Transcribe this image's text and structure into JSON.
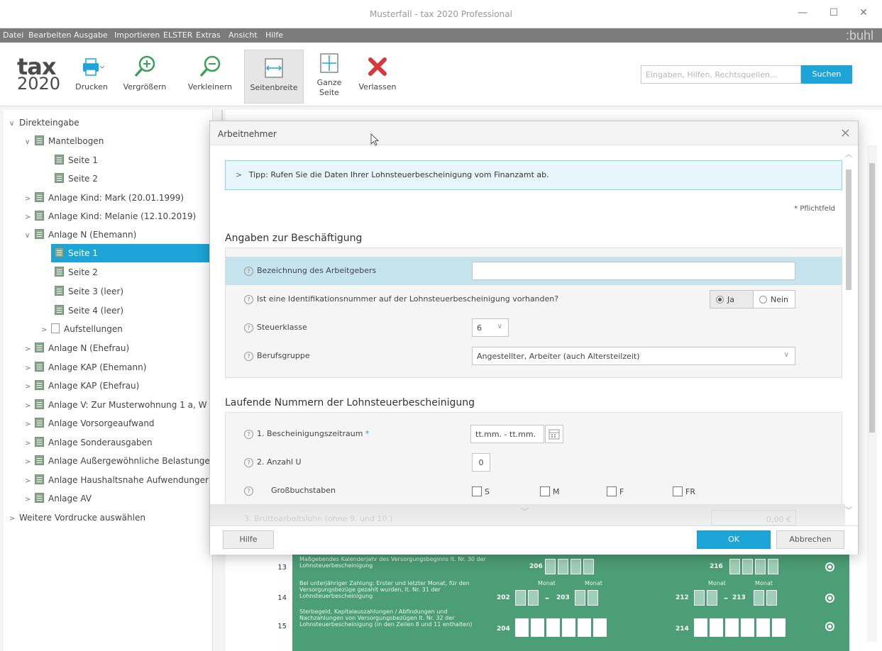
{
  "window": {
    "title": "Musterfall - tax 2020 Professional",
    "min_glyph": "—",
    "max_glyph": "☐",
    "close_glyph": "✕"
  },
  "menu": {
    "items": [
      "Datei",
      "Bearbeiten",
      "Ausgabe",
      "Importieren",
      "ELSTER",
      "Extras",
      "Ansicht",
      "Hilfe"
    ],
    "brand": ":buhl"
  },
  "logo": {
    "line1": "tax",
    "line2": "2020"
  },
  "toolbar": {
    "buttons": [
      {
        "label": "Drucken",
        "icon": "printer-icon"
      },
      {
        "label": "Vergrößern",
        "icon": "zoom-in-icon"
      },
      {
        "label": "Verkleinern",
        "icon": "zoom-out-icon"
      },
      {
        "label": "Seitenbreite",
        "icon": "page-width-icon"
      },
      {
        "label": "Ganze Seite",
        "icon": "whole-page-icon"
      },
      {
        "label": "Verlassen",
        "icon": "exit-icon"
      }
    ],
    "search_placeholder": "Eingaben, Hilfen, Rechtsquellen...",
    "search_button": "Suchen"
  },
  "tree": [
    {
      "label": "Direkteingabe",
      "chevron": "∨"
    },
    {
      "label": "Mantelbogen",
      "chevron": "∨"
    },
    {
      "label": "Seite 1"
    },
    {
      "label": "Seite 2"
    },
    {
      "label": "Anlage Kind: Mark (20.01.1999)",
      "chevron": ">"
    },
    {
      "label": "Anlage Kind: Melanie (12.10.2019)",
      "chevron": ">"
    },
    {
      "label": "Anlage N (Ehemann)",
      "chevron": "∨"
    },
    {
      "label": "Seite 1",
      "selected": true
    },
    {
      "label": "Seite 2"
    },
    {
      "label": "Seite 3 (leer)"
    },
    {
      "label": "Seite 4 (leer)"
    },
    {
      "label": "Aufstellungen",
      "chevron": ">"
    },
    {
      "label": "Anlage N (Ehefrau)",
      "chevron": ">"
    },
    {
      "label": "Anlage KAP (Ehemann)",
      "chevron": ">"
    },
    {
      "label": "Anlage KAP (Ehefrau)",
      "chevron": ">"
    },
    {
      "label": "Anlage V: Zur Musterwohnung 1 a, W",
      "chevron": ">"
    },
    {
      "label": "Anlage Vorsorgeaufwand",
      "chevron": ">"
    },
    {
      "label": "Anlage Sonderausgaben",
      "chevron": ">"
    },
    {
      "label": "Anlage Außergewöhnliche Belastunge",
      "chevron": ">"
    },
    {
      "label": "Anlage Haushaltsnahe Aufwendunger",
      "chevron": ">"
    },
    {
      "label": "Anlage AV",
      "chevron": ">"
    },
    {
      "label": "Weitere Vordrucke auswählen",
      "chevron": ">"
    }
  ],
  "form": {
    "rows": [
      {
        "num": "13",
        "text": "Maßgebendes Kalenderjahr des Versorgungsbeginns lt. Nr. 30 der Lohnsteuerbescheinigung",
        "f1": "206",
        "f2": "216"
      },
      {
        "num": "14",
        "text": "Bei unterjähriger Zahlung: Erster und letzter Monat, für den Versorgungsbezüge gezahlt wurden, lt. Nr. 31 der Lohnsteuerbescheinigung",
        "f1": "202",
        "f1b": "203",
        "f2": "212",
        "f2b": "213",
        "sub1": "Monat",
        "sub2": "Monat"
      },
      {
        "num": "15",
        "text": "Sterbegeld, Kapitalauszahlungen / Abfindungen und Nachzahlungen von Versorgungsbezügen lt. Nr. 32 der Lohnsteuerbescheinigung (in den Zeilen 8 und 11 enthalten)",
        "f1": "204",
        "f2": "214"
      }
    ],
    "mm": "M"
  },
  "dialog": {
    "title": "Arbeitnehmer",
    "tip": "Tipp: Rufen Sie die Daten Ihrer Lohnsteuerbescheinigung vom Finanzamt ab.",
    "tip_chevron": ">",
    "required_note": "* Pflichtfeld",
    "section1": {
      "title": "Angaben zur Beschäftigung",
      "employer_label": "Bezeichnung des Arbeitgebers",
      "employer_value": "",
      "idnr_label": "Ist eine Identifikationsnummer auf der Lohnsteuerbescheinigung vorhanden?",
      "idnr_yes": "Ja",
      "idnr_no": "Nein",
      "idnr_selected": "Ja",
      "taxclass_label": "Steuerklasse",
      "taxclass_value": "6",
      "occupation_label": "Berufsgruppe",
      "occupation_value": "Angestellter, Arbeiter (auch Altersteilzeit)"
    },
    "section2": {
      "title": "Laufende Nummern der Lohnsteuerbescheinigung",
      "period_label": "1. Bescheinigungszeitraum",
      "required_star": "*",
      "period_value": "tt.mm. - tt.mm.",
      "count_label": "2. Anzahl U",
      "count_value": "0",
      "letters_label": "Großbuchstaben",
      "checkboxes": [
        "S",
        "M",
        "F",
        "FR"
      ],
      "faded_label": "3. Bruttoarbeitslohn (ohne 9. und 10.)",
      "faded_value": "0,00 €"
    },
    "help_button": "Hilfe",
    "ok_button": "OK",
    "cancel_button": "Abbrechen"
  },
  "colors": {
    "accent": "#1ca5d6",
    "form_green": "#4c9e76",
    "menubar": "#7b7b7b"
  }
}
